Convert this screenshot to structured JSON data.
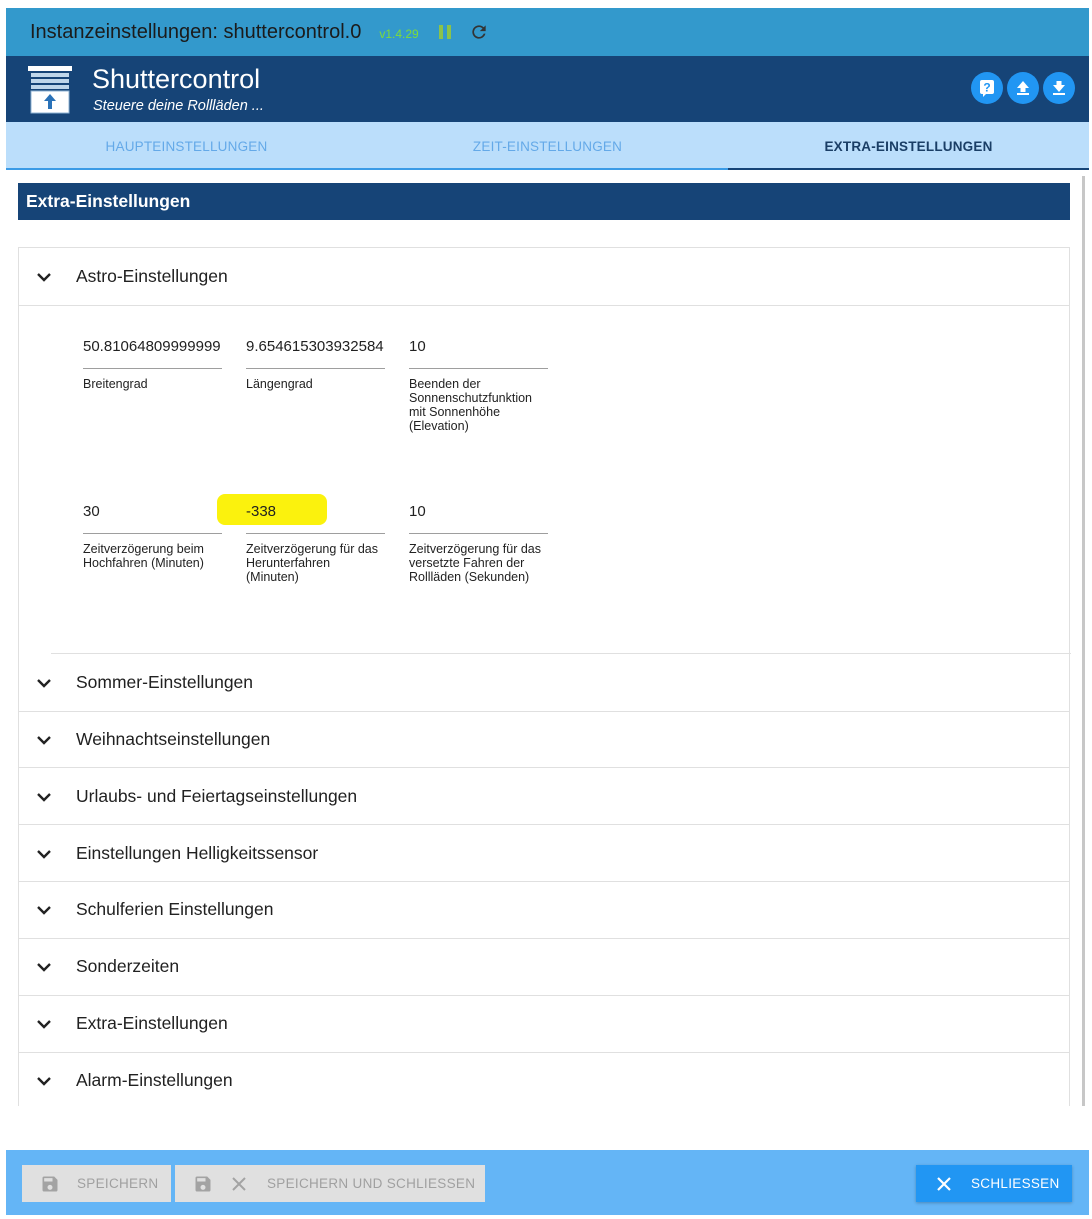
{
  "window": {
    "title": "Instanzeinstellungen: shuttercontrol.0",
    "version": "v1.4.29"
  },
  "header": {
    "app_name": "Shuttercontrol",
    "subtitle": "Steuere deine Rollläden ...",
    "buttons": [
      "help-icon",
      "upload-icon",
      "download-icon"
    ]
  },
  "tabs": [
    {
      "label": "HAUPTEINSTELLUNGEN",
      "active": false
    },
    {
      "label": "ZEIT-EINSTELLUNGEN",
      "active": false
    },
    {
      "label": "EXTRA-EINSTELLUNGEN",
      "active": true
    }
  ],
  "section_title": "Extra-Einstellungen",
  "astro": {
    "title": "Astro-Einstellungen",
    "expanded": true,
    "fields": [
      {
        "value": "50.81064809999999",
        "label": "Breitengrad"
      },
      {
        "value": "9.654615303932584",
        "label": "Längengrad"
      },
      {
        "value": "10",
        "label": "Beenden der Sonnenschutzfunktion mit Sonnenhöhe (Elevation)"
      },
      {
        "value": "30",
        "label": "Zeitverzögerung beim Hochfahren (Minuten)"
      },
      {
        "value": "-338",
        "label": "Zeitverzögerung für das Herunterfahren (Minuten)",
        "highlighted": true
      },
      {
        "value": "10",
        "label": "Zeitverzögerung für das versetzte Fahren der Rollläden (Sekunden)"
      }
    ]
  },
  "sections": [
    "Sommer-Einstellungen",
    "Weihnachtseinstellungen",
    "Urlaubs- und Feiertagseinstellungen",
    "Einstellungen Helligkeitssensor",
    "Schulferien Einstellungen",
    "Sonderzeiten",
    "Extra-Einstellungen",
    "Alarm-Einstellungen"
  ],
  "footer": {
    "save": "SPEICHERN",
    "save_close": "SPEICHERN UND SCHLIESSEN",
    "close": "SCHLIESSEN"
  },
  "colors": {
    "titlebar": "#3399cc",
    "header": "#164477",
    "tabs_bg": "#bbdefb",
    "accent": "#2196f3",
    "highlight": "#fbf20d",
    "version": "#7cdb3a"
  }
}
